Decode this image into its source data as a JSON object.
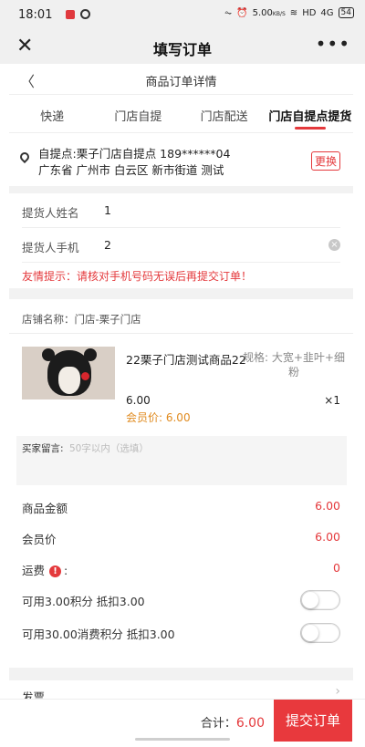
{
  "status": {
    "time": "18:01",
    "net": "5.00",
    "net_unit": "KB/S",
    "hd": "HD",
    "signal": "4G",
    "battery": "54"
  },
  "title_bar": {
    "title": "填写订单"
  },
  "subheader": {
    "title": "商品订单详情"
  },
  "tabs": [
    {
      "label": "快递"
    },
    {
      "label": "门店自提"
    },
    {
      "label": "门店配送"
    },
    {
      "label": "门店自提点提货"
    }
  ],
  "address": {
    "line1": "自提点:栗子门店自提点 189******04",
    "line2": "广东省 广州市 白云区 新市街道 测试",
    "change_label": "更换"
  },
  "pickup": {
    "name_label": "提货人姓名",
    "name_value": "1",
    "phone_label": "提货人手机",
    "phone_value": "2",
    "tip": "友情提示：请核对手机号码无误后再提交订单！"
  },
  "store": {
    "name": "店铺名称：门店-栗子门店"
  },
  "goods": {
    "name": "22栗子门店测试商品22",
    "spec": "规格: 大宽+韭叶+细粉",
    "price": "6.00",
    "qty": "×1",
    "member_price": "会员价: 6.00"
  },
  "memo": {
    "label": "买家留言:",
    "placeholder": "50字以内（选填）"
  },
  "summary": {
    "goods_amount_label": "商品金额",
    "goods_amount": "6.00",
    "member_price_label": "会员价",
    "member_price": "6.00",
    "shipping_label": "运费",
    "shipping_colon": ":",
    "shipping": "0",
    "points1_label": "可用3.00积分 抵扣3.00",
    "points1_on": false,
    "points2_label": "可用30.00消费积分 抵扣3.00",
    "points2_on": false
  },
  "invoice": {
    "label": "发票"
  },
  "footer": {
    "total_label": "合计：",
    "total": "6.00",
    "submit_label": "提交订单"
  },
  "colors": {
    "accent": "#e4393c",
    "member": "#e08a1e",
    "background": "#f2f2f2"
  }
}
